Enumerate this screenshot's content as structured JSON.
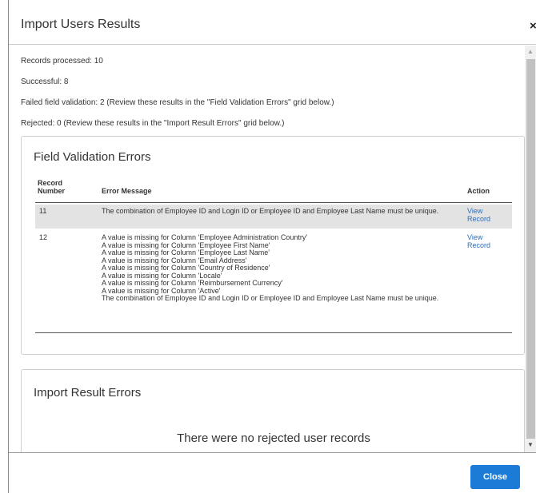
{
  "dialog": {
    "title": "Import Users Results",
    "close_glyph": "×",
    "close_button_label": "Close"
  },
  "summary": {
    "records_processed": "Records processed: 10",
    "successful": "Successful: 8",
    "failed_validation": "Failed field validation: 2 (Review these results in the \"Field Validation Errors\" grid below.)",
    "rejected": "Rejected: 0 (Review these results in the \"Import Result Errors\" grid below.)"
  },
  "field_validation": {
    "title": "Field Validation Errors",
    "columns": {
      "record_number": "Record Number",
      "error_message": "Error Message",
      "action": "Action"
    },
    "rows": [
      {
        "record": "11",
        "messages": [
          "The combination of Employee ID and Login ID or Employee ID and Employee Last Name must be unique."
        ],
        "action": "View Record"
      },
      {
        "record": "12",
        "messages": [
          "A value is missing for Column 'Employee Administration Country'",
          "A value is missing for Column 'Employee First Name'",
          "A value is missing for Column 'Employee Last Name'",
          "A value is missing for Column 'Email Address'",
          "A value is missing for Column 'Country of Residence'",
          "A value is missing for Column 'Locale'",
          "A value is missing for Column 'Reimbursement Currency'",
          "A value is missing for Column 'Active'",
          "The combination of Employee ID and Login ID or Employee ID and Employee Last Name must be unique."
        ],
        "action": "View Record"
      }
    ]
  },
  "import_result": {
    "title": "Import Result Errors",
    "empty_message": "There were no rejected user records"
  },
  "colors": {
    "primary_button": "#1c7bd6",
    "link": "#2a6ebb",
    "highlight_row": "#e3e3e3"
  },
  "icons": {
    "close": "close-icon",
    "scroll_up": "arrow-up-icon",
    "scroll_down": "arrow-down-icon"
  }
}
